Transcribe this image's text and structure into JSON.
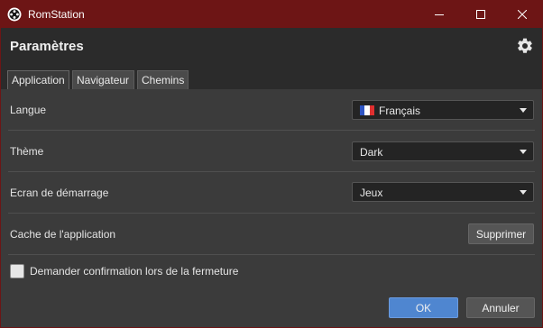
{
  "window": {
    "title": "RomStation",
    "icon": "romstation-logo-icon",
    "controls": [
      "minimize-icon",
      "maximize-icon",
      "close-icon"
    ]
  },
  "header": {
    "title": "Paramètres",
    "settings_icon": "gear-icon"
  },
  "tabs": [
    {
      "label": "Application",
      "active": true
    },
    {
      "label": "Navigateur",
      "active": false
    },
    {
      "label": "Chemins",
      "active": false
    }
  ],
  "settings": {
    "language": {
      "label": "Langue",
      "value": "Français",
      "flag": "france-flag-icon"
    },
    "theme": {
      "label": "Thème",
      "value": "Dark"
    },
    "startup": {
      "label": "Ecran de démarrage",
      "value": "Jeux"
    },
    "cache": {
      "label": "Cache de l'application",
      "button": "Supprimer"
    },
    "confirm_close": {
      "label": "Demander confirmation lors de la fermeture",
      "checked": false
    }
  },
  "footer": {
    "ok": "OK",
    "cancel": "Annuler"
  },
  "colors": {
    "titlebar": "#6d1515",
    "header": "#2b2b2b",
    "panel": "#3b3b3b",
    "accent": "#4f86d0"
  }
}
